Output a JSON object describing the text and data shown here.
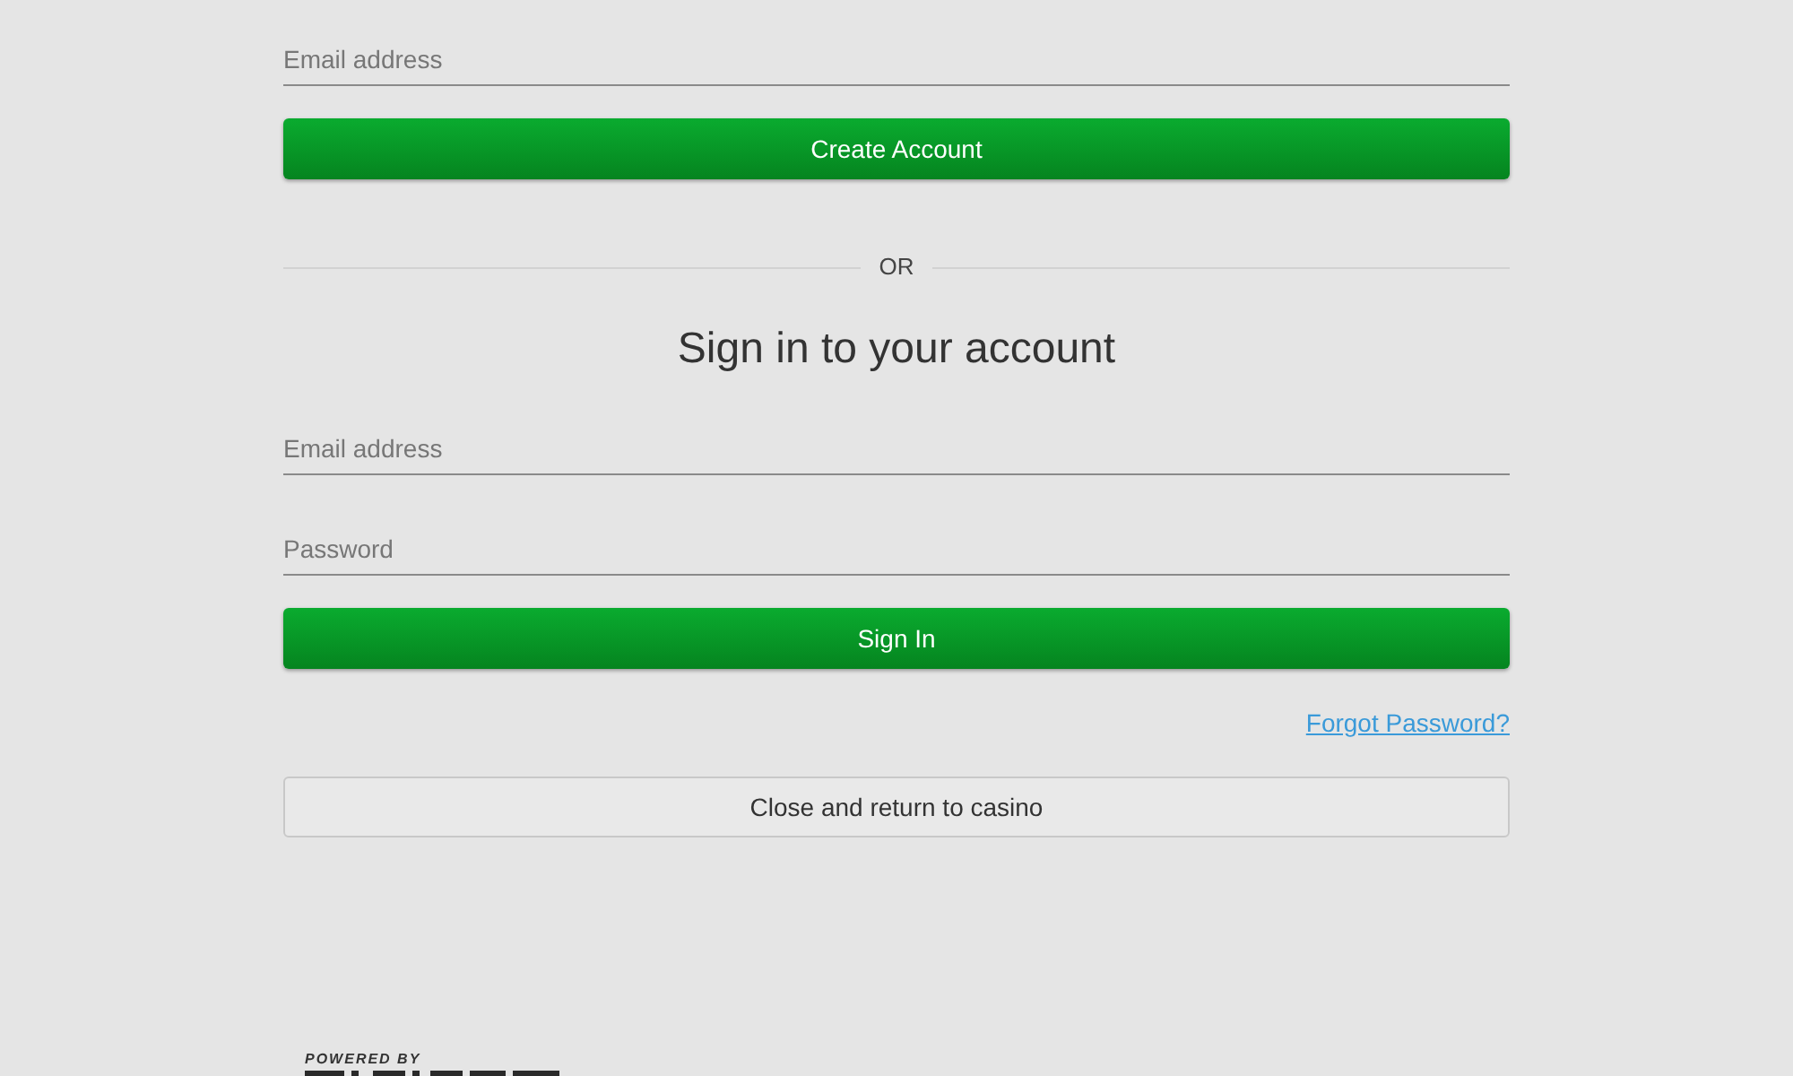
{
  "signup": {
    "email_field": {
      "placeholder": "Email address"
    },
    "button": "Create Account"
  },
  "divider": {
    "label": "OR"
  },
  "signin": {
    "title": "Sign in to your account",
    "fields": [
      {
        "placeholder": "Email address"
      },
      {
        "placeholder": "Password"
      }
    ],
    "button": "Sign In",
    "forgot_link": "Forgot Password?"
  },
  "close_button": "Close and return to casino",
  "footer": {
    "powered_by": "POWERED BY"
  }
}
